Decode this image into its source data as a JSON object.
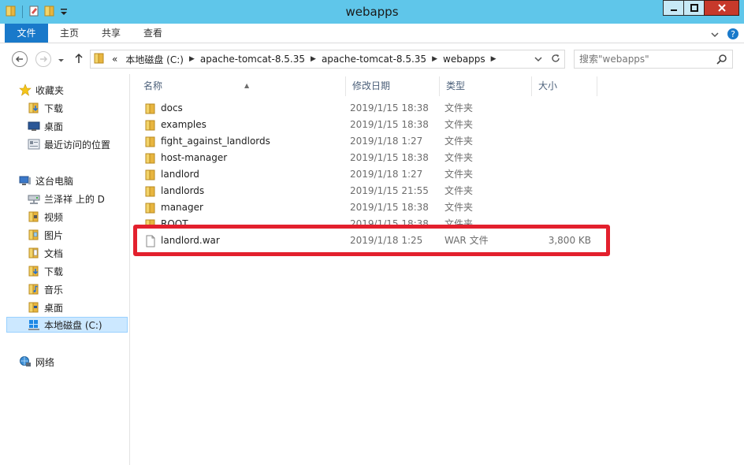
{
  "window": {
    "title": "webapps",
    "controls": {
      "minimize_icon": "minimize-icon",
      "maximize_icon": "maximize-icon",
      "close_icon": "close-icon"
    }
  },
  "ribbon": {
    "tabs": [
      {
        "label": "文件",
        "active": true
      },
      {
        "label": "主页"
      },
      {
        "label": "共享"
      },
      {
        "label": "查看"
      }
    ]
  },
  "address": {
    "overflow": "«",
    "crumbs": [
      "本地磁盘 (C:)",
      "apache-tomcat-8.5.35",
      "apache-tomcat-8.5.35",
      "webapps"
    ]
  },
  "search": {
    "placeholder": "搜索\"webapps\""
  },
  "nav": {
    "favorites": {
      "label": "收藏夹",
      "items": [
        "下载",
        "桌面",
        "最近访问的位置"
      ]
    },
    "computer": {
      "label": "这台电脑",
      "items": [
        "兰泽祥 上的 D",
        "视频",
        "图片",
        "文档",
        "下载",
        "音乐",
        "桌面",
        "本地磁盘 (C:)"
      ]
    },
    "network": {
      "label": "网络"
    }
  },
  "columns": {
    "name": "名称",
    "date": "修改日期",
    "type": "类型",
    "size": "大小"
  },
  "files": [
    {
      "name": "docs",
      "date": "2019/1/15 18:38",
      "type": "文件夹",
      "size": "",
      "kind": "folder"
    },
    {
      "name": "examples",
      "date": "2019/1/15 18:38",
      "type": "文件夹",
      "size": "",
      "kind": "folder"
    },
    {
      "name": "fight_against_landlords",
      "date": "2019/1/18 1:27",
      "type": "文件夹",
      "size": "",
      "kind": "folder"
    },
    {
      "name": "host-manager",
      "date": "2019/1/15 18:38",
      "type": "文件夹",
      "size": "",
      "kind": "folder"
    },
    {
      "name": "landlord",
      "date": "2019/1/18 1:27",
      "type": "文件夹",
      "size": "",
      "kind": "folder"
    },
    {
      "name": "landlords",
      "date": "2019/1/15 21:55",
      "type": "文件夹",
      "size": "",
      "kind": "folder"
    },
    {
      "name": "manager",
      "date": "2019/1/15 18:38",
      "type": "文件夹",
      "size": "",
      "kind": "folder"
    },
    {
      "name": "ROOT",
      "date": "2019/1/15 18:38",
      "type": "文件夹",
      "size": "",
      "kind": "folder"
    },
    {
      "name": "landlord.war",
      "date": "2019/1/18 1:25",
      "type": "WAR 文件",
      "size": "3,800 KB",
      "kind": "file"
    }
  ],
  "colors": {
    "titlebar": "#5fc6ea",
    "file_tab": "#1979ca",
    "folder": "#e8b53f",
    "highlight": "#e3202d",
    "close_button": "#c7392b"
  }
}
